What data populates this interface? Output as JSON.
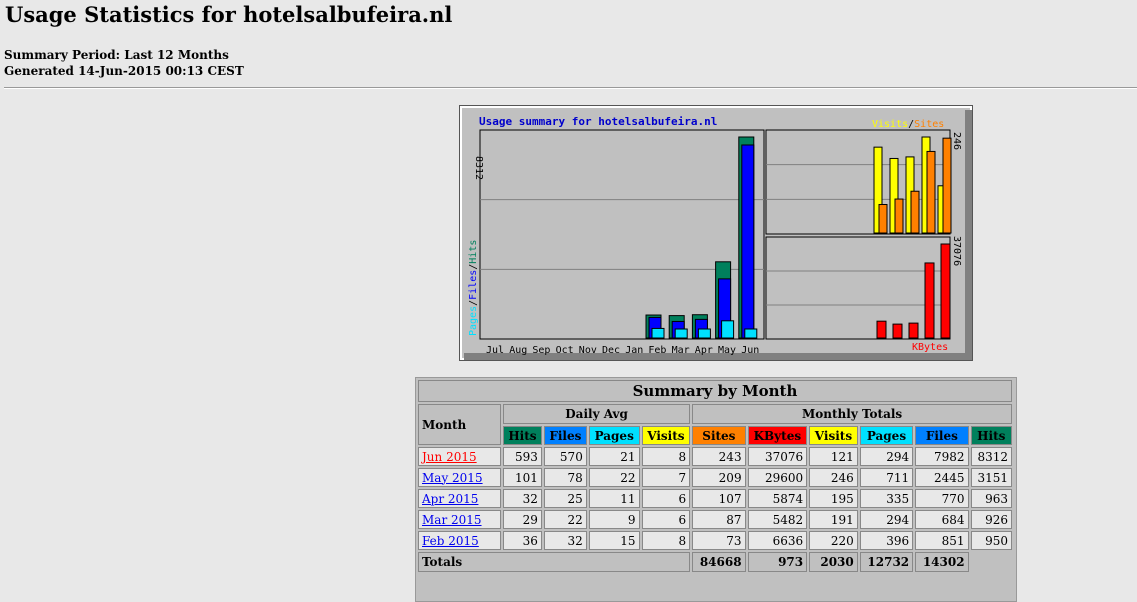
{
  "page": {
    "title": "Usage Statistics for hotelsalbufeira.nl",
    "summary_period": "Summary Period: Last 12 Months",
    "generated": "Generated 14-Jun-2015 00:13 CEST"
  },
  "colors": {
    "hits": "#00805c",
    "files": "#0000ff",
    "pages": "#00e0ff",
    "visits": "#ffff00",
    "sites": "#ff8000",
    "kbytes": "#ff0000"
  },
  "chart_data": {
    "type": "bar",
    "title": "Usage summary for hotelsalbufeira.nl",
    "categories": [
      "Jul",
      "Aug",
      "Sep",
      "Oct",
      "Nov",
      "Dec",
      "Jan",
      "Feb",
      "Mar",
      "Apr",
      "May",
      "Jun"
    ],
    "left_axis_label": [
      "Pages",
      "/",
      "Files",
      "/",
      "Hits"
    ],
    "left_max_label": "8312",
    "visits_sites_max_label": "246",
    "kbytes_max_label": "37076",
    "visits_sites_legend": [
      "Visits",
      "/",
      "Sites"
    ],
    "kbytes_legend": "KBytes",
    "series": [
      {
        "name": "Hits",
        "values": [
          0,
          0,
          0,
          0,
          0,
          0,
          0,
          950,
          926,
          963,
          3151,
          8312
        ]
      },
      {
        "name": "Files",
        "values": [
          0,
          0,
          0,
          0,
          0,
          0,
          0,
          851,
          684,
          770,
          2445,
          7982
        ]
      },
      {
        "name": "Pages",
        "values": [
          0,
          0,
          0,
          0,
          0,
          0,
          0,
          396,
          294,
          335,
          711,
          294
        ]
      },
      {
        "name": "Visits",
        "values": [
          0,
          0,
          0,
          0,
          0,
          0,
          0,
          220,
          191,
          195,
          246,
          121
        ]
      },
      {
        "name": "Sites",
        "values": [
          0,
          0,
          0,
          0,
          0,
          0,
          0,
          73,
          87,
          107,
          209,
          243
        ]
      },
      {
        "name": "KBytes",
        "values": [
          0,
          0,
          0,
          0,
          0,
          0,
          0,
          6636,
          5482,
          5874,
          29600,
          37076
        ]
      }
    ]
  },
  "table": {
    "title": "Summary by Month",
    "month_header": "Month",
    "daily_avg": "Daily Avg",
    "monthly_totals": "Monthly Totals",
    "cols": {
      "hits": "Hits",
      "files": "Files",
      "pages": "Pages",
      "visits": "Visits",
      "sites": "Sites",
      "kbytes": "KBytes"
    },
    "rows": [
      {
        "month": "Jun 2015",
        "d_hits": "593",
        "d_files": "570",
        "d_pages": "21",
        "d_visits": "8",
        "sites": "243",
        "kbytes": "37076",
        "visits": "121",
        "pages": "294",
        "files": "7982",
        "hits": "8312"
      },
      {
        "month": "May 2015",
        "d_hits": "101",
        "d_files": "78",
        "d_pages": "22",
        "d_visits": "7",
        "sites": "209",
        "kbytes": "29600",
        "visits": "246",
        "pages": "711",
        "files": "2445",
        "hits": "3151"
      },
      {
        "month": "Apr 2015",
        "d_hits": "32",
        "d_files": "25",
        "d_pages": "11",
        "d_visits": "6",
        "sites": "107",
        "kbytes": "5874",
        "visits": "195",
        "pages": "335",
        "files": "770",
        "hits": "963"
      },
      {
        "month": "Mar 2015",
        "d_hits": "29",
        "d_files": "22",
        "d_pages": "9",
        "d_visits": "6",
        "sites": "87",
        "kbytes": "5482",
        "visits": "191",
        "pages": "294",
        "files": "684",
        "hits": "926"
      },
      {
        "month": "Feb 2015",
        "d_hits": "36",
        "d_files": "32",
        "d_pages": "15",
        "d_visits": "8",
        "sites": "73",
        "kbytes": "6636",
        "visits": "220",
        "pages": "396",
        "files": "851",
        "hits": "950"
      }
    ],
    "totals": {
      "label": "Totals",
      "kbytes": "84668",
      "visits": "973",
      "pages": "2030",
      "files": "12732",
      "hits": "14302"
    }
  }
}
